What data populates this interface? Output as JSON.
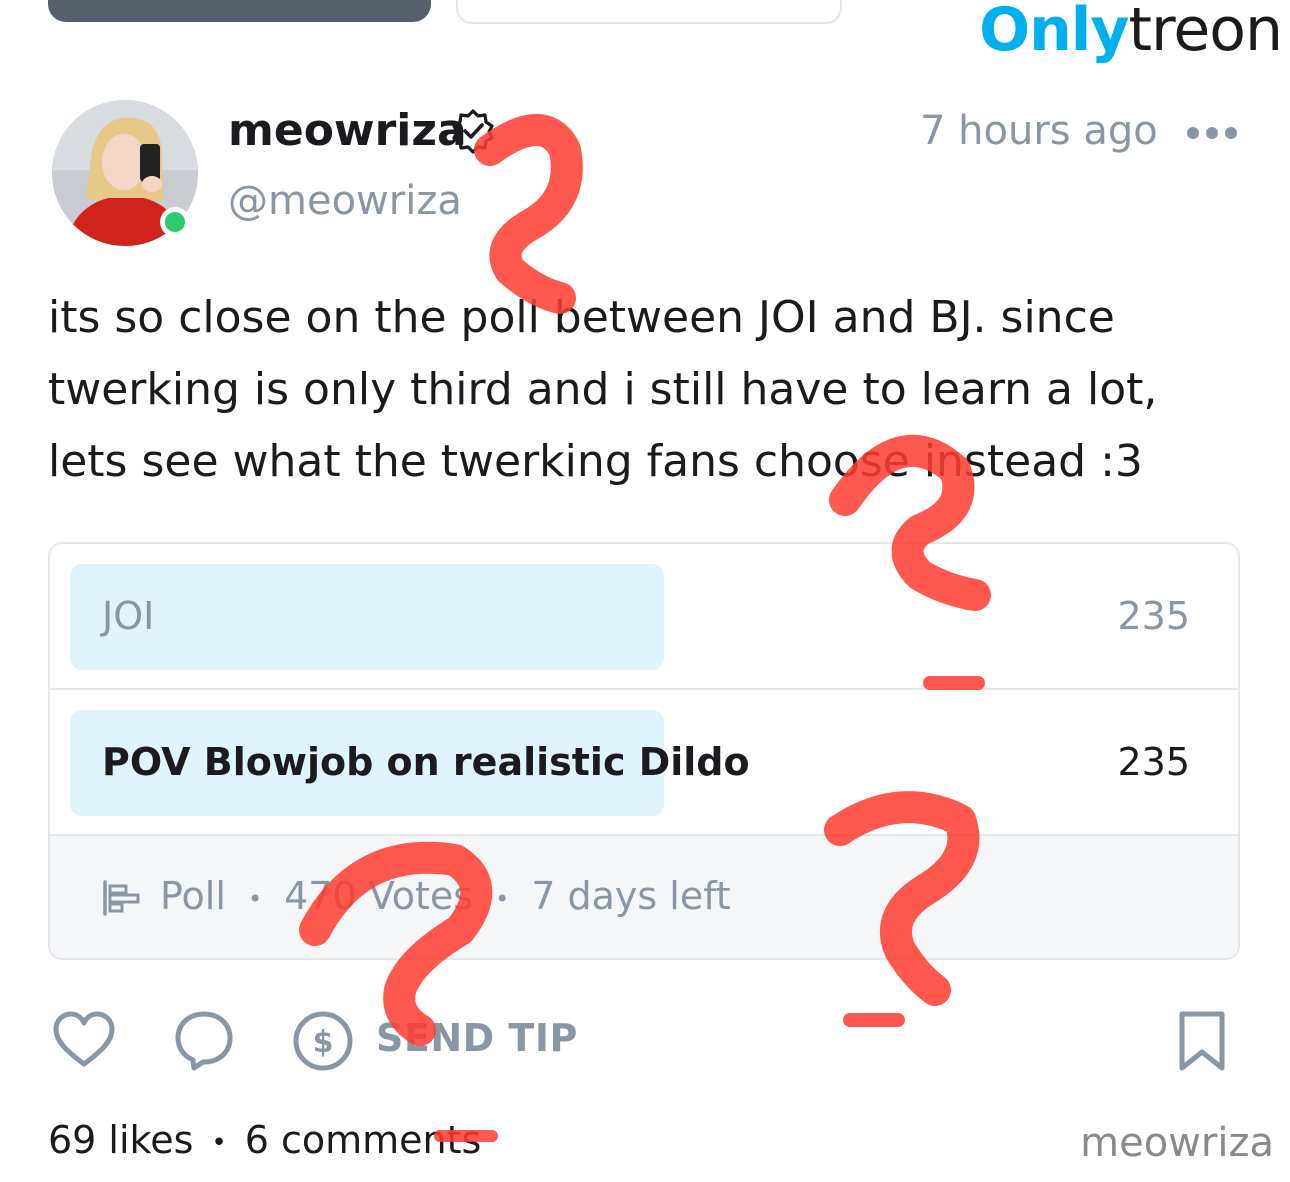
{
  "watermark": {
    "brand_part1": "Only",
    "brand_part2": "treon",
    "creator": "meowriza"
  },
  "post": {
    "author_name": "meowriza",
    "author_handle": "@meowriza",
    "time": "7 hours ago",
    "text": "its so close on the poll between JOI and BJ. since twerking is only third and i still have to learn a lot, lets see what the twerking fans choose instead :3"
  },
  "poll": {
    "options": [
      {
        "label": "JOI",
        "count": "235",
        "fraction": 0.5
      },
      {
        "label": "POV Blowjob on realistic Dildo",
        "count": "235",
        "fraction": 0.5
      }
    ],
    "type_label": "Poll",
    "votes": "470 Votes",
    "time_left": "7 days left"
  },
  "actions": {
    "send_tip_label": "SEND TIP"
  },
  "stats": {
    "likes": "69 likes",
    "comments": "6 comments"
  },
  "colors": {
    "brand": "#00aff0",
    "muted": "#8a96a3",
    "poll_fill": "#dff4fd",
    "online": "#2ecc71",
    "scribble": "#ff3b2f"
  },
  "icons": [
    "verified-icon",
    "more-icon",
    "poll-icon",
    "heart-icon",
    "comment-icon",
    "dollar-icon",
    "bookmark-icon"
  ]
}
